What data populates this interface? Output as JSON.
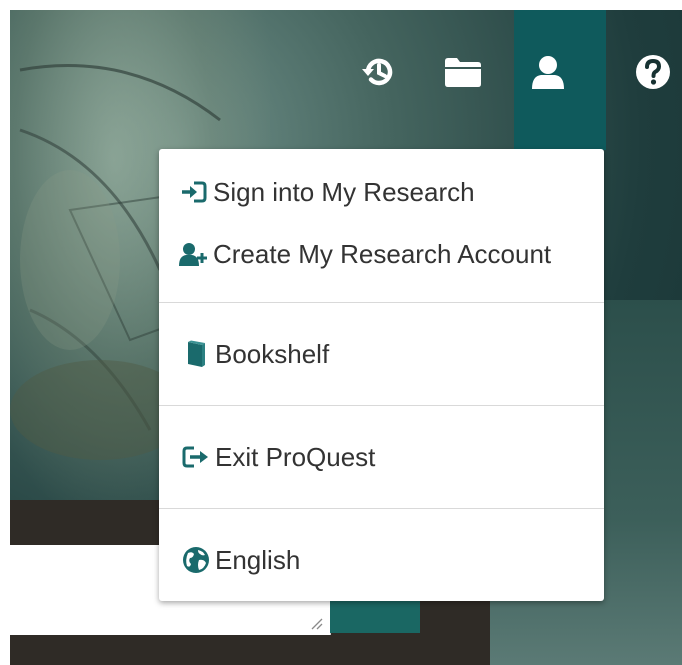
{
  "toolbar": {
    "icons": [
      {
        "name": "recent-searches-icon"
      },
      {
        "name": "folder-icon"
      },
      {
        "name": "user-icon"
      },
      {
        "name": "help-icon"
      }
    ]
  },
  "account_menu": {
    "sign_in": {
      "label": "Sign into My Research",
      "icon": "sign-in-icon"
    },
    "create_account": {
      "label": "Create My Research Account",
      "icon": "add-user-icon"
    },
    "bookshelf": {
      "label": "Bookshelf",
      "icon": "book-icon"
    },
    "exit": {
      "label": "Exit ProQuest",
      "icon": "sign-out-icon"
    },
    "language": {
      "label": "English",
      "icon": "globe-icon"
    }
  },
  "colors": {
    "accent": "#0f5a5c",
    "icon_teal": "#1a6a6c",
    "menu_text": "#333333"
  }
}
